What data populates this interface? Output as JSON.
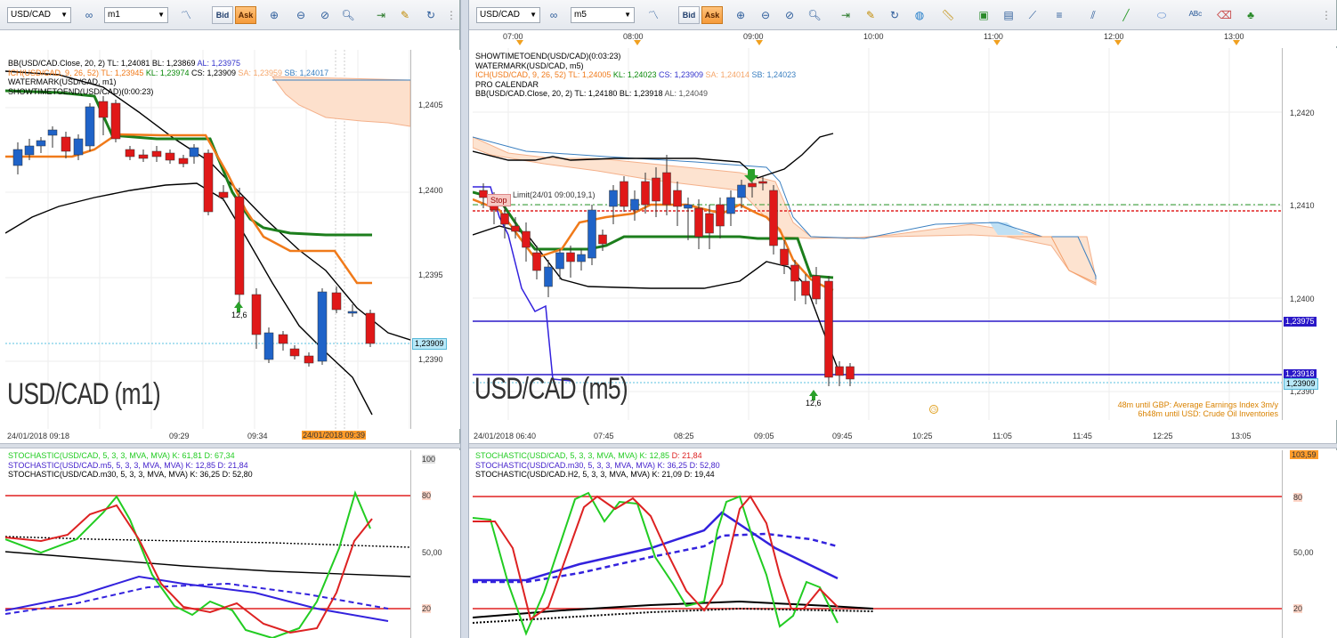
{
  "left": {
    "toolbar": {
      "symbol": "USD/CAD",
      "timeframe": "m1",
      "bid": "Bid",
      "ask": "Ask"
    },
    "indicators": [
      {
        "parts": [
          {
            "t": "BB(USD/CAD.Close, 20, 2)  TL: 1,24081  BL: 1,23869  ",
            "c": "#000000"
          },
          {
            "t": "AL: 1,23975",
            "c": "#3333cc"
          }
        ]
      },
      {
        "parts": [
          {
            "t": "ICH(USD/CAD, 9, 26, 52)  TL: 1,23945  ",
            "c": "#f07a1a"
          },
          {
            "t": "KL: 1,23974  ",
            "c": "#0a8a0a"
          },
          {
            "t": "CS: 1,23909  ",
            "c": "#000000"
          },
          {
            "t": "SA: 1,23959  ",
            "c": "#f5a66a"
          },
          {
            "t": "SB: 1,24017",
            "c": "#3a7fc0"
          }
        ]
      },
      {
        "parts": [
          {
            "t": "WATERMARK(USD/CAD, m1)",
            "c": "#000000"
          }
        ]
      },
      {
        "parts": [
          {
            "t": "SHOWTIMETOEND(USD/CAD)(0:00:23)",
            "c": "#000000"
          }
        ]
      }
    ],
    "y_labels": [
      "1,2405",
      "1,2400",
      "1,2395",
      "1,2390"
    ],
    "price_tag": "1,23909",
    "watermark": "USD/CAD (m1)",
    "x_labels": [
      "24/01/2018 09:18",
      "09:29",
      "09:34"
    ],
    "x_highlight": "24/01/2018 09:39",
    "arrow_label": "12,6",
    "stoch": {
      "lines": [
        {
          "t": "STOCHASTIC(USD/CAD, 5, 3, 3, MVA, MVA)  K: 61,81  D: 67,34",
          "c": "#22cc22"
        },
        {
          "t": "STOCHASTIC(USD/CAD.m5, 5, 3, 3, MVA, MVA)  K: 12,85  D: 21,84",
          "c": "#4422cc"
        },
        {
          "t": "STOCHASTIC(USD/CAD.m30, 5, 3, 3, MVA, MVA)  K: 36,25  D: 52,80",
          "c": "#000000"
        }
      ],
      "y_labels": [
        "100",
        "80",
        "50,00",
        "20"
      ]
    }
  },
  "right": {
    "toolbar": {
      "symbol": "USD/CAD",
      "timeframe": "m5",
      "bid": "Bid",
      "ask": "Ask"
    },
    "top_times": [
      "07:00",
      "08:00",
      "09:00",
      "10:00",
      "11:00",
      "12:00",
      "13:00"
    ],
    "indicators": [
      {
        "parts": [
          {
            "t": "SHOWTIMETOEND(USD/CAD)(0:03:23)",
            "c": "#000000"
          }
        ]
      },
      {
        "parts": [
          {
            "t": "WATERMARK(USD/CAD, m5)",
            "c": "#000000"
          }
        ]
      },
      {
        "parts": [
          {
            "t": "ICH(USD/CAD, 9, 26, 52)  TL: 1,24005  ",
            "c": "#f07a1a"
          },
          {
            "t": "KL: 1,24023  ",
            "c": "#0a8a0a"
          },
          {
            "t": "CS: 1,23909  ",
            "c": "#3333cc"
          },
          {
            "t": "SA: 1,24014  ",
            "c": "#f5a66a"
          },
          {
            "t": "SB: 1,24023",
            "c": "#3a7fc0"
          }
        ]
      },
      {
        "parts": [
          {
            "t": "PRO CALENDAR",
            "c": "#000000"
          }
        ]
      },
      {
        "parts": [
          {
            "t": "BB(USD/CAD.Close, 20, 2)  TL: 1,24180  BL: 1,23918  ",
            "c": "#000000"
          },
          {
            "t": "AL: 1,24049",
            "c": "#555555"
          }
        ]
      }
    ],
    "y_labels": [
      "1,2420",
      "1,2410",
      "1,2400",
      "1,2390"
    ],
    "tag_blue1": "1,23975",
    "tag_blue2": "1,23918",
    "tag_price": "1,23909",
    "stop_label": "Stop",
    "order_label": "Limit(24/01 09:00,19,1)",
    "watermark": "USD/CAD (m5)",
    "news": [
      "48m until GBP: Average Earnings Index 3m/y",
      "6h48m until USD: Crude Oil Inventories"
    ],
    "x_labels": [
      "24/01/2018 06:40",
      "07:45",
      "08:25",
      "09:05",
      "09:45",
      "10:25",
      "11:05",
      "11:45",
      "12:25",
      "13:05"
    ],
    "arrow_label": "12,6",
    "stoch": {
      "lines": [
        {
          "t": "STOCHASTIC(USD/CAD, 5, 3, 3, MVA, MVA)  K: 12,85  ",
          "c": "#22cc22",
          "d": "D: 21,84",
          "dc": "#dd2222"
        },
        {
          "t": "STOCHASTIC(USD/CAD.m30, 5, 3, 3, MVA, MVA)  K: 36,25  D: 52,80",
          "c": "#4422cc"
        },
        {
          "t": "STOCHASTIC(USD/CAD.H2, 5, 3, 3, MVA, MVA)  K: 21,09  D: 19,44",
          "c": "#000000"
        }
      ],
      "y_labels": [
        "80",
        "50,00",
        "20"
      ],
      "top_tag": "103,59"
    }
  }
}
